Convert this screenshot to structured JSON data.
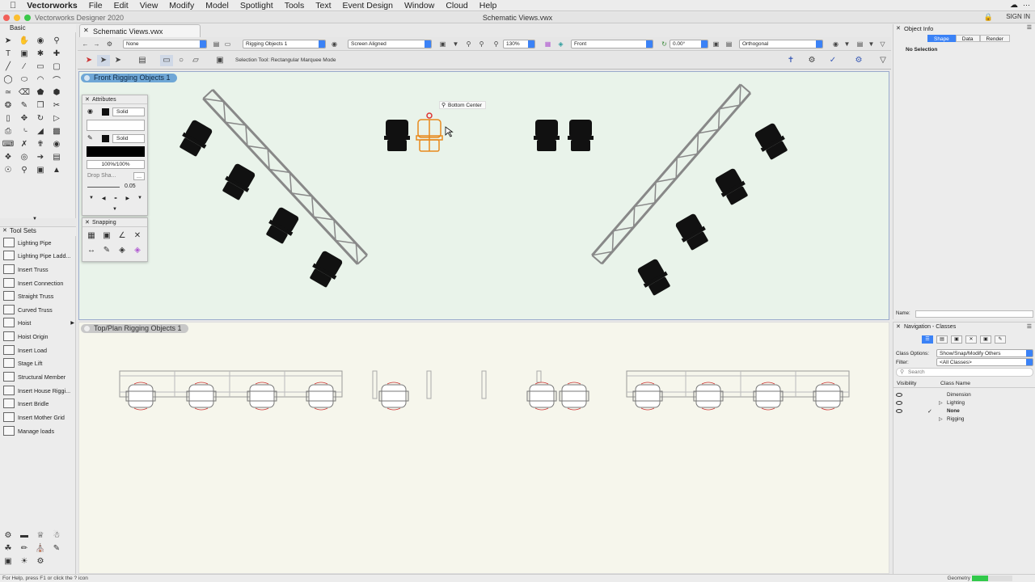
{
  "menubar": {
    "app_name": "Vectorworks",
    "items": [
      "File",
      "Edit",
      "View",
      "Modify",
      "Model",
      "Spotlight",
      "Tools",
      "Text",
      "Event Design",
      "Window",
      "Cloud",
      "Help"
    ],
    "sign_in": "SIGN IN"
  },
  "window": {
    "app_title": "Vectorworks Designer 2020",
    "doc_title": "Schematic Views.vwx",
    "tab_label": "Schematic Views.vwx"
  },
  "view_bar": {
    "class_select": "None",
    "layer_select": "Rigging Objects 1",
    "plane_select": "Screen Aligned",
    "zoom": "130%",
    "view_select": "Front",
    "rotation": "0.00°",
    "projection_select": "Orthogonal"
  },
  "mode_bar": {
    "mode_text": "Selection Tool: Rectangular Marquee Mode"
  },
  "palettes": {
    "basic_title": "Basic",
    "tool_sets_title": "Tool Sets",
    "tool_sets": [
      "Lighting Pipe",
      "Lighting Pipe Ladd...",
      "Insert Truss",
      "Insert Connection",
      "Straight Truss",
      "Curved Truss",
      "Hoist",
      "Hoist Origin",
      "Insert Load",
      "Stage Lift",
      "Structural Member",
      "Insert House Riggi...",
      "Insert Bridle",
      "Insert Mother Grid",
      "Manage loads"
    ],
    "attributes": {
      "title": "Attributes",
      "fill_style": "Solid",
      "pen_style": "Solid",
      "opacity": "100%/100%",
      "drop_shadow": "Drop Sha...",
      "line_weight": "0.05"
    },
    "snapping": {
      "title": "Snapping"
    }
  },
  "viewports": {
    "top_label": "Front  Rigging Objects 1",
    "bottom_label": "Top/Plan  Rigging Objects 1",
    "tooltip": "Bottom Center"
  },
  "object_info": {
    "title": "Object Info",
    "tabs": [
      "Shape",
      "Data",
      "Render"
    ],
    "selection": "No Selection",
    "name_label": "Name:"
  },
  "navigation": {
    "title": "Navigation - Classes",
    "class_options_label": "Class Options:",
    "class_options_value": "Show/Snap/Modify Others",
    "filter_label": "Filter:",
    "filter_value": "<All Classes>",
    "search_placeholder": "Search",
    "col_visibility": "Visibility",
    "col_class_name": "Class Name",
    "classes": [
      "Dimension",
      "Lighting",
      "None",
      "Rigging"
    ]
  },
  "status": {
    "help_text": "For Help, press F1 or click the ? icon",
    "geometry_label": "Geometry",
    "geometry_progress": 0.4
  },
  "colors": {
    "accent": "#3b82f6",
    "viewport_front_bg": "#e9f3ea",
    "viewport_top_bg": "#f6f6ec",
    "selected_fixture": "#e8891c"
  }
}
